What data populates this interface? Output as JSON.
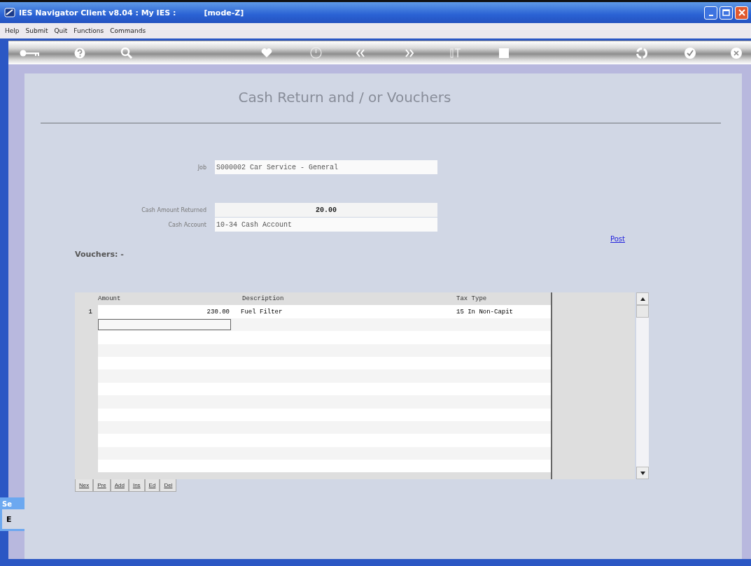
{
  "window": {
    "title": "IES Navigator Client v8.04 : My IES :",
    "mode": "[mode-Z]"
  },
  "menu": [
    "Help",
    "Submit",
    "Quit",
    "Functions",
    "Commands"
  ],
  "form": {
    "title": "Cash Return and / or Vouchers",
    "fields": [
      {
        "label": "Job",
        "value": "S000002 Car Service - General",
        "kind": "text"
      },
      {
        "label": "Cash Amount Returned",
        "value": "20.00",
        "kind": "amount"
      },
      {
        "label": "Cash Account",
        "value": "10-34 Cash Account",
        "kind": "text"
      }
    ]
  },
  "post_link": "Post",
  "vouchers": {
    "label": "Vouchers: -",
    "columns": [
      "Amount",
      "Description",
      "Tax Type"
    ],
    "rows": [
      {
        "number": "1",
        "amount": "230.00",
        "description": "Fuel Filter",
        "tax_type": "15 In Non-Capit"
      }
    ],
    "new_row": {
      "focused": true
    }
  },
  "buttons": [
    "Nex",
    "Pre",
    "Add",
    "Ins",
    "Ed",
    "Del"
  ],
  "side_window": {
    "title": "Se",
    "text": "E"
  }
}
